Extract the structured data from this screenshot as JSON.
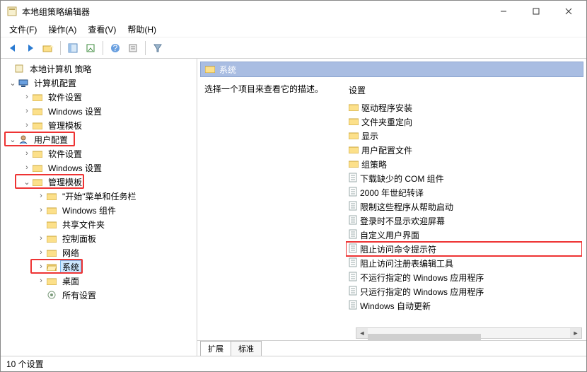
{
  "window": {
    "title": "本地组策略编辑器"
  },
  "menu": {
    "file": "文件(F)",
    "action": "操作(A)",
    "view": "查看(V)",
    "help": "帮助(H)"
  },
  "tree": {
    "root": "本地计算机 策略",
    "computer": "计算机配置",
    "c_soft": "软件设置",
    "c_win": "Windows 设置",
    "c_admin": "管理模板",
    "user": "用户配置",
    "u_soft": "软件设置",
    "u_win": "Windows 设置",
    "u_admin": "管理模板",
    "start_task": "\"开始\"菜单和任务栏",
    "win_comp": "Windows 组件",
    "shared": "共享文件夹",
    "ctrl": "控制面板",
    "net": "网络",
    "sys": "系统",
    "desk": "桌面",
    "all": "所有设置"
  },
  "right": {
    "header": "系统",
    "desc": "选择一个项目来查看它的描述。",
    "settings_label": "设置",
    "items": [
      {
        "type": "folder",
        "text": "驱动程序安装"
      },
      {
        "type": "folder",
        "text": "文件夹重定向"
      },
      {
        "type": "folder",
        "text": "显示"
      },
      {
        "type": "folder",
        "text": "用户配置文件"
      },
      {
        "type": "folder",
        "text": "组策略"
      },
      {
        "type": "page",
        "text": "下载缺少的 COM 组件"
      },
      {
        "type": "page",
        "text": "2000 年世纪转译"
      },
      {
        "type": "page",
        "text": "限制这些程序从帮助启动"
      },
      {
        "type": "page",
        "text": "登录时不显示欢迎屏幕"
      },
      {
        "type": "page",
        "text": "自定义用户界面"
      },
      {
        "type": "page",
        "text": "阻止访问命令提示符",
        "hl": true
      },
      {
        "type": "page",
        "text": "阻止访问注册表编辑工具"
      },
      {
        "type": "page",
        "text": "不运行指定的 Windows 应用程序"
      },
      {
        "type": "page",
        "text": "只运行指定的 Windows 应用程序"
      },
      {
        "type": "page",
        "text": "Windows 自动更新"
      }
    ]
  },
  "tabs": {
    "ext": "扩展",
    "std": "标准"
  },
  "status": "10 个设置"
}
